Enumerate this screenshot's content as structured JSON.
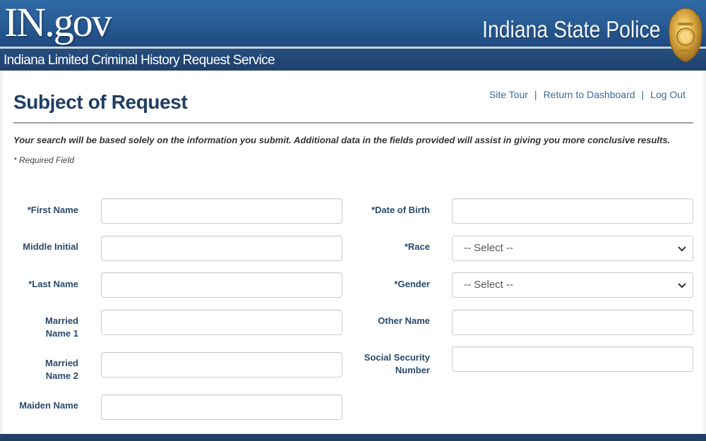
{
  "header": {
    "logo_text": "IN.gov",
    "agency_name": "Indiana State Police",
    "service_title": "Indiana Limited Criminal History Request Service",
    "badge_icon": "police-badge-icon"
  },
  "page": {
    "title": "Subject of Request",
    "notice": "Your search will be based solely on the information you submit. Additional data in the fields provided will assist in giving you more conclusive results.",
    "required_note": "* Required Field"
  },
  "nav_links": {
    "site_tour": "Site Tour",
    "separator": "|",
    "return_dashboard": "Return to Dashboard",
    "log_out": "Log Out"
  },
  "form": {
    "left": [
      {
        "label": "*First Name",
        "value": ""
      },
      {
        "label": "Middle Initial",
        "value": ""
      },
      {
        "label": "*Last Name",
        "value": ""
      },
      {
        "label": "Married Name 1",
        "value": ""
      },
      {
        "label": "Married Name 2",
        "value": ""
      },
      {
        "label": "Maiden Name",
        "value": ""
      }
    ],
    "right": [
      {
        "label": "*Date of Birth",
        "value": ""
      },
      {
        "label": "*Race",
        "selected": "-- Select --"
      },
      {
        "label": "*Gender",
        "selected": "-- Select --"
      },
      {
        "label": "Other Name",
        "value": ""
      },
      {
        "label": "Social Security Number",
        "value": ""
      }
    ]
  },
  "colors": {
    "brand_blue": "#2a5f98",
    "title_navy": "#1f3e63",
    "link_blue": "#3b6a9b",
    "footer_navy": "#213f66"
  }
}
